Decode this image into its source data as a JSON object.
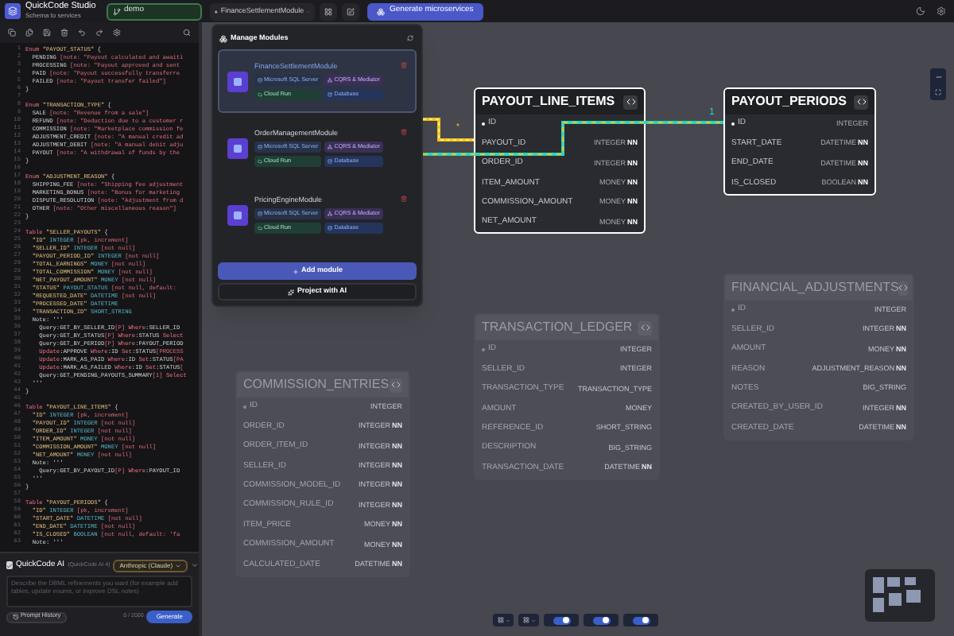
{
  "app": {
    "title": "QuickCode Studio",
    "subtitle": "Schema to services"
  },
  "project_select": {
    "value": "demo"
  },
  "module_select": {
    "value": "FinanceSettlementModule"
  },
  "generate_button": "Generate microservices",
  "editor": {
    "lines": [
      {
        "n": "1",
        "text": "Enum \"PAYOUT_STATUS\" {"
      },
      {
        "n": "2",
        "text": "  PENDING [note: \"Payout calculated and awaiti"
      },
      {
        "n": "3",
        "text": "  PROCESSING [note: \"Payout approved and sent"
      },
      {
        "n": "4",
        "text": "  PAID [note: \"Payout successfully transferre"
      },
      {
        "n": "5",
        "text": "  FAILED [note: \"Payout transfer failed\"]"
      },
      {
        "n": "6",
        "text": "}"
      },
      {
        "n": "7"
      },
      {
        "n": "8",
        "text": "Enum \"TRANSACTION_TYPE\" {"
      },
      {
        "n": "9",
        "text": "  SALE [note: \"Revenue from a sale\"]"
      },
      {
        "n": "10",
        "text": "  REFUND [note: \"Deduction due to a customer r"
      },
      {
        "n": "11",
        "text": "  COMMISSION [note: \"Marketplace commission fe"
      },
      {
        "n": "12",
        "text": "  ADJUSTMENT_CREDIT [note: \"A manual credit ad"
      },
      {
        "n": "13",
        "text": "  ADJUSTMENT_DEBIT [note: \"A manual debit adju"
      },
      {
        "n": "14",
        "text": "  PAYOUT [note: \"A withdrawal of funds by the"
      },
      {
        "n": "15",
        "text": "}"
      },
      {
        "n": "16"
      },
      {
        "n": "17",
        "text": "Enum \"ADJUSTMENT_REASON\" {"
      },
      {
        "n": "18",
        "text": "  SHIPPING_FEE [note: \"Shipping fee adjustment"
      },
      {
        "n": "19",
        "text": "  MARKETING_BONUS [note: \"Bonus for marketing"
      },
      {
        "n": "20",
        "text": "  DISPUTE_RESOLUTION [note: \"Adjustment from d"
      },
      {
        "n": "21",
        "text": "  OTHER [note: \"Other miscellaneous reason\"]"
      },
      {
        "n": "22",
        "text": "}"
      },
      {
        "n": "23"
      },
      {
        "n": "24",
        "text": "Table \"SELLER_PAYOUTS\" {"
      },
      {
        "n": "25",
        "text": "  \"ID\" INTEGER [pk, increment]"
      },
      {
        "n": "26",
        "text": "  \"SELLER_ID\" INTEGER [not null]"
      },
      {
        "n": "27",
        "text": "  \"PAYOUT_PERIOD_ID\" INTEGER [not null]"
      },
      {
        "n": "28",
        "text": "  \"TOTAL_EARNINGS\" MONEY [not null]"
      },
      {
        "n": "29",
        "text": "  \"TOTAL_COMMISSION\" MONEY [not null]"
      },
      {
        "n": "30",
        "text": "  \"NET_PAYOUT_AMOUNT\" MONEY [not null]"
      },
      {
        "n": "31",
        "text": "  \"STATUS\" PAYOUT_STATUS [not null, default:"
      },
      {
        "n": "32",
        "text": "  \"REQUESTED_DATE\" DATETIME [not null]"
      },
      {
        "n": "33",
        "text": "  \"PROCESSED_DATE\" DATETIME"
      },
      {
        "n": "34",
        "text": "  \"TRANSACTION_ID\" SHORT_STRING"
      },
      {
        "n": "35",
        "text": "  Note: '''"
      },
      {
        "n": "36",
        "text": "    Query:GET_BY_SELLER_ID[P] Where:SELLER_ID"
      },
      {
        "n": "37",
        "text": "    Query:GET_BY_STATUS[P] Where:STATUS Select"
      },
      {
        "n": "38",
        "text": "    Query:GET_BY_PERIOD[P] Where:PAYOUT_PERIOD"
      },
      {
        "n": "39",
        "text": "    Update:APPROVE Where:ID Set:STATUS[PROCESS"
      },
      {
        "n": "40",
        "text": "    Update:MARK_AS_PAID Where:ID Set:STATUS[PA"
      },
      {
        "n": "41",
        "text": "    Update:MARK_AS_FAILED Where:ID Set:STATUS["
      },
      {
        "n": "42",
        "text": "    Query:GET_PENDING_PAYOUTS_SUMMARY[1] Select"
      },
      {
        "n": "43",
        "text": "  '''"
      },
      {
        "n": "44",
        "text": "}"
      },
      {
        "n": "45"
      },
      {
        "n": "46",
        "text": "Table \"PAYOUT_LINE_ITEMS\" {"
      },
      {
        "n": "47",
        "text": "  \"ID\" INTEGER [pk, increment]"
      },
      {
        "n": "48",
        "text": "  \"PAYOUT_ID\" INTEGER [not null]"
      },
      {
        "n": "49",
        "text": "  \"ORDER_ID\" INTEGER [not null]"
      },
      {
        "n": "50",
        "text": "  \"ITEM_AMOUNT\" MONEY [not null]"
      },
      {
        "n": "51",
        "text": "  \"COMMISSION_AMOUNT\" MONEY [not null]"
      },
      {
        "n": "52",
        "text": "  \"NET_AMOUNT\" MONEY [not null]"
      },
      {
        "n": "53",
        "text": "  Note: '''"
      },
      {
        "n": "54",
        "text": "    Query:GET_BY_PAYOUT_ID[P] Where:PAYOUT_ID"
      },
      {
        "n": "55",
        "text": "  '''"
      },
      {
        "n": "56",
        "text": "}"
      },
      {
        "n": "57"
      },
      {
        "n": "58",
        "text": "Table \"PAYOUT_PERIODS\" {"
      },
      {
        "n": "59",
        "text": "  \"ID\" INTEGER [pk, increment]"
      },
      {
        "n": "60",
        "text": "  \"START_DATE\" DATETIME [not null]"
      },
      {
        "n": "61",
        "text": "  \"END_DATE\" DATETIME [not null]"
      },
      {
        "n": "62",
        "text": "  \"IS_CLOSED\" BOOLEAN [not null, default: 'fa"
      },
      {
        "n": "63",
        "text": "  Note: '''"
      }
    ]
  },
  "ai_panel": {
    "enabled": true,
    "title": "QuickCode AI",
    "model": "(QuickCode AI 4)",
    "provider": "Anthropic (Claude)",
    "placeholder": "Describe the DBML refinements you want (for example add tables, update enums, or improve DSL notes)",
    "history_button": "Prompt History",
    "counter": "0 / 2000",
    "generate_button": "Generate"
  },
  "modules_panel": {
    "title": "Manage Modules",
    "modules": [
      {
        "name": "FinanceSettlementModule",
        "selected": true,
        "badges": [
          {
            "kind": "db",
            "label": "Microsoft SQL Server"
          },
          {
            "kind": "arch",
            "label": "CQRS & Mediator"
          },
          {
            "kind": "deploy",
            "label": "Cloud Run"
          },
          {
            "kind": "storage",
            "label": "Database"
          }
        ]
      },
      {
        "name": "OrderManagementModule",
        "selected": false,
        "badges": [
          {
            "kind": "db",
            "label": "Microsoft SQL Server"
          },
          {
            "kind": "arch",
            "label": "CQRS & Mediator"
          },
          {
            "kind": "deploy",
            "label": "Cloud Run"
          },
          {
            "kind": "storage",
            "label": "Database"
          }
        ]
      },
      {
        "name": "PricingEngineModule",
        "selected": false,
        "badges": [
          {
            "kind": "db",
            "label": "Microsoft SQL Server"
          },
          {
            "kind": "arch",
            "label": "CQRS & Mediator"
          },
          {
            "kind": "deploy",
            "label": "Cloud Run"
          },
          {
            "kind": "storage",
            "label": "Database"
          }
        ]
      }
    ],
    "add_button": "Add module",
    "ai_button": "Project with AI"
  },
  "tables": [
    {
      "name": "PAYOUT_LINE_ITEMS",
      "selected": true,
      "fields": [
        {
          "name": "ID",
          "pk": true
        },
        {
          "name": "PAYOUT_ID",
          "type": "INTEGER",
          "nn": "NN"
        },
        {
          "name": "ORDER_ID",
          "type": "INTEGER",
          "nn": "NN"
        },
        {
          "name": "ITEM_AMOUNT",
          "type": "MONEY",
          "nn": "NN"
        },
        {
          "name": "COMMISSION_AMOUNT",
          "type": "MONEY",
          "nn": "NN"
        },
        {
          "name": "NET_AMOUNT",
          "type": "MONEY",
          "nn": "NN"
        }
      ]
    },
    {
      "name": "PAYOUT_PERIODS",
      "selected": true,
      "fields": [
        {
          "name": "ID",
          "type": "INTEGER",
          "pk": true
        },
        {
          "name": "START_DATE",
          "type": "DATETIME",
          "nn": "NN"
        },
        {
          "name": "END_DATE",
          "type": "DATETIME",
          "nn": "NN"
        },
        {
          "name": "IS_CLOSED",
          "type": "BOOLEAN",
          "nn": "NN"
        }
      ]
    },
    {
      "name": "FINANCIAL_ADJUSTMENTS",
      "selected": false,
      "fields": [
        {
          "name": "ID",
          "type": "INTEGER",
          "pk": true
        },
        {
          "name": "SELLER_ID",
          "type": "INTEGER",
          "nn": "NN"
        },
        {
          "name": "AMOUNT",
          "type": "MONEY",
          "nn": "NN"
        },
        {
          "name": "REASON",
          "type": "ADJUSTMENT_REASON",
          "nn": "NN"
        },
        {
          "name": "NOTES",
          "type": "BIG_STRING"
        },
        {
          "name": "CREATED_BY_USER_ID",
          "type": "INTEGER",
          "nn": "NN"
        },
        {
          "name": "CREATED_DATE",
          "type": "DATETIME",
          "nn": "NN"
        }
      ]
    },
    {
      "name": "TRANSACTION_LEDGER",
      "selected": false,
      "fields": [
        {
          "name": "ID",
          "type": "INTEGER",
          "pk": true
        },
        {
          "name": "SELLER_ID",
          "type": "INTEGER"
        },
        {
          "name": "TRANSACTION_TYPE",
          "type": "TRANSACTION_TYPE"
        },
        {
          "name": "AMOUNT",
          "type": "MONEY"
        },
        {
          "name": "REFERENCE_ID",
          "type": "SHORT_STRING"
        },
        {
          "name": "DESCRIPTION",
          "type": "BIG_STRING"
        },
        {
          "name": "TRANSACTION_DATE",
          "type": "DATETIME",
          "nn": "NN"
        }
      ]
    },
    {
      "name": "COMMISSION_ENTRIES",
      "selected": false,
      "fields": [
        {
          "name": "ID",
          "type": "INTEGER",
          "pk": true
        },
        {
          "name": "ORDER_ID",
          "type": "INTEGER",
          "nn": "NN"
        },
        {
          "name": "ORDER_ITEM_ID",
          "type": "INTEGER",
          "nn": "NN"
        },
        {
          "name": "SELLER_ID",
          "type": "INTEGER",
          "nn": "NN"
        },
        {
          "name": "COMMISSION_MODEL_ID",
          "type": "INTEGER",
          "nn": "NN"
        },
        {
          "name": "COMMISSION_RULE_ID",
          "type": "INTEGER",
          "nn": "NN"
        },
        {
          "name": "ITEM_PRICE",
          "type": "MONEY",
          "nn": "NN"
        },
        {
          "name": "COMMISSION_AMOUNT",
          "type": "MONEY",
          "nn": "NN"
        },
        {
          "name": "CALCULATED_DATE",
          "type": "DATETIME",
          "nn": "NN"
        }
      ]
    }
  ],
  "relations": [
    {
      "color": "#f5c518",
      "label": "*"
    },
    {
      "color": "#2dd4bf",
      "label": "1"
    }
  ],
  "canvas_controls": [
    {
      "kind": "dropdown"
    },
    {
      "kind": "dropdown"
    },
    {
      "kind": "switch",
      "on": true
    },
    {
      "kind": "switch",
      "on": true
    },
    {
      "kind": "switch",
      "on": true
    }
  ]
}
